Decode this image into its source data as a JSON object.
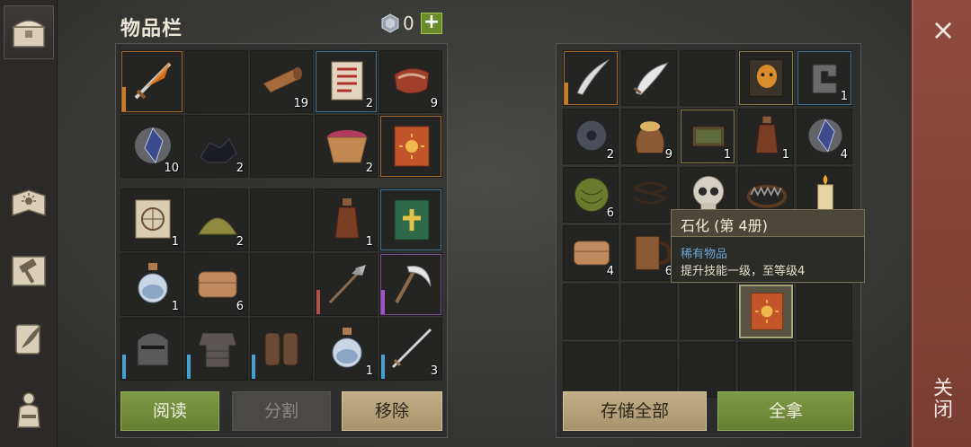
{
  "inventory": {
    "title": "物品栏",
    "gems": "0",
    "plus": "+",
    "buttons": {
      "read": "阅读",
      "split": "分割",
      "remove": "移除"
    }
  },
  "storage": {
    "buttons": {
      "store_all": "存储全部",
      "take_all": "全拿"
    }
  },
  "close": {
    "icon": "×",
    "label": "关闭"
  },
  "tooltip": {
    "title": "石化 (第 4册)",
    "rarity": "稀有物品",
    "description": "提升技能一级，至等级4"
  },
  "inventory_cells": [
    {
      "item": "flaming-sword",
      "qty": "",
      "rarity": "orange",
      "bar": "#c97b25"
    },
    {
      "item": "empty",
      "qty": ""
    },
    {
      "item": "leather-roll",
      "qty": "19"
    },
    {
      "item": "red-scroll",
      "qty": "2",
      "rarity": "blue"
    },
    {
      "item": "raw-meat",
      "qty": "9"
    },
    {
      "item": "blue-crystal",
      "qty": "10"
    },
    {
      "item": "coal",
      "qty": "2"
    },
    {
      "item": "empty",
      "qty": ""
    },
    {
      "item": "berry-bowl",
      "qty": "2"
    },
    {
      "item": "orange-book",
      "qty": "",
      "rarity": "orange"
    },
    {
      "item": "map-scroll",
      "qty": "1"
    },
    {
      "item": "sand-pile",
      "qty": "2"
    },
    {
      "item": "empty",
      "qty": ""
    },
    {
      "item": "bottle",
      "qty": "1"
    },
    {
      "item": "green-book",
      "qty": "",
      "rarity": "blue"
    },
    {
      "item": "potion",
      "qty": "1"
    },
    {
      "item": "cloth",
      "qty": "6"
    },
    {
      "item": "empty",
      "qty": ""
    },
    {
      "item": "halberd",
      "qty": "",
      "bar": "#b0504a"
    },
    {
      "item": "scythe",
      "qty": "",
      "rarity": "purple",
      "bar": "#9b57c4"
    },
    {
      "item": "knight-helmet",
      "qty": "",
      "bar": "#4aa0d0"
    },
    {
      "item": "chain-armor",
      "qty": "",
      "bar": "#4aa0d0"
    },
    {
      "item": "gauntlets",
      "qty": "",
      "bar": "#4aa0d0"
    },
    {
      "item": "potion",
      "qty": "1"
    },
    {
      "item": "longsword",
      "qty": "3",
      "bar": "#4aa0d0"
    }
  ],
  "storage_cells": [
    {
      "item": "curved-blade",
      "qty": "",
      "rarity": "orange",
      "bar": "#c97b25"
    },
    {
      "item": "scimitar",
      "qty": ""
    },
    {
      "item": "empty",
      "qty": ""
    },
    {
      "item": "mask-book",
      "qty": "",
      "rarity": "gold"
    },
    {
      "item": "metal-clamp",
      "qty": "1",
      "rarity": "blue"
    },
    {
      "item": "gear",
      "qty": "2"
    },
    {
      "item": "grain-sack",
      "qty": "9"
    },
    {
      "item": "tray",
      "qty": "1",
      "rarity": "gold"
    },
    {
      "item": "bottle",
      "qty": "1"
    },
    {
      "item": "blue-crystal",
      "qty": "4"
    },
    {
      "item": "herb-ball",
      "qty": "6"
    },
    {
      "item": "wire",
      "qty": ""
    },
    {
      "item": "skull",
      "qty": ""
    },
    {
      "item": "trap",
      "qty": ""
    },
    {
      "item": "candle",
      "qty": ""
    },
    {
      "item": "cloth",
      "qty": "4"
    },
    {
      "item": "mug",
      "qty": "6"
    },
    {
      "item": "empty",
      "qty": ""
    },
    {
      "item": "empty",
      "qty": ""
    },
    {
      "item": "empty",
      "qty": ""
    },
    {
      "item": "empty",
      "qty": ""
    },
    {
      "item": "empty",
      "qty": ""
    },
    {
      "item": "empty",
      "qty": ""
    },
    {
      "item": "orange-book",
      "qty": "",
      "rarity": "selected"
    },
    {
      "item": "empty",
      "qty": ""
    },
    {
      "item": "empty",
      "qty": ""
    },
    {
      "item": "empty",
      "qty": ""
    },
    {
      "item": "empty",
      "qty": ""
    },
    {
      "item": "empty",
      "qty": ""
    },
    {
      "item": "empty",
      "qty": ""
    }
  ],
  "sidebar": [
    {
      "icon": "chest-icon",
      "active": true
    },
    {
      "icon": "sun-book-icon"
    },
    {
      "icon": "hammer-icon"
    },
    {
      "icon": "quill-scroll-icon"
    },
    {
      "icon": "character-icon"
    }
  ]
}
